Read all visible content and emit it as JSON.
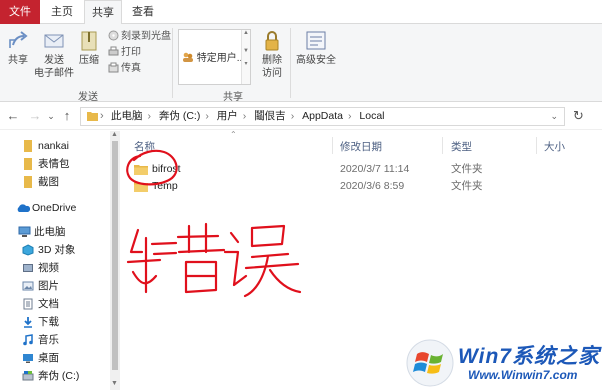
{
  "tabs": {
    "file": "文件",
    "home": "主页",
    "share": "共享",
    "view": "查看"
  },
  "ribbon": {
    "share_label": "共享",
    "send_label1": "发送",
    "send_label2": "电子邮件",
    "zip_label": "压缩",
    "burn_label": "刻录到光盘",
    "print_label": "打印",
    "fax_label": "传真",
    "group_send": "发送",
    "specific_users": "特定用户...",
    "group_share": "共享",
    "remove_access1": "删除",
    "remove_access2": "访问",
    "advanced_security": "高级安全"
  },
  "addressbar": {
    "crumbs": [
      "此电脑",
      "奔伪 (C:)",
      "用户",
      "鬮佷吉",
      "AppData",
      "Local"
    ]
  },
  "sidebar": {
    "items": [
      {
        "label": "nankai",
        "icon": "folder-icon"
      },
      {
        "label": "表情包",
        "icon": "folder-icon"
      },
      {
        "label": "截图",
        "icon": "folder-icon"
      },
      {
        "label": "OneDrive",
        "icon": "cloud-icon"
      },
      {
        "label": "此电脑",
        "icon": "computer-icon"
      },
      {
        "label": "3D 对象",
        "icon": "cube-icon"
      },
      {
        "label": "视频",
        "icon": "video-icon"
      },
      {
        "label": "图片",
        "icon": "picture-icon"
      },
      {
        "label": "文档",
        "icon": "document-icon"
      },
      {
        "label": "下载",
        "icon": "download-icon"
      },
      {
        "label": "音乐",
        "icon": "music-icon"
      },
      {
        "label": "桌面",
        "icon": "desktop-icon"
      },
      {
        "label": "奔伪 (C:)",
        "icon": "drive-icon"
      }
    ]
  },
  "list": {
    "columns": {
      "name": "名称",
      "modified": "修改日期",
      "type": "类型",
      "size": "大小"
    },
    "rows": [
      {
        "name": "bifrost",
        "modified": "2020/3/7 11:14",
        "type": "文件夹"
      },
      {
        "name": "Temp",
        "modified": "2020/3/6 8:59",
        "type": "文件夹"
      }
    ]
  },
  "annotation": {
    "handwritten_text": "错误",
    "color": "#e0101c"
  },
  "watermark": {
    "brand": "Win7系统之家",
    "url": "Www.Winwin7.com"
  },
  "colors": {
    "file_tab": "#c4232f",
    "folder": "#e8b94a",
    "column_header": "#4d6083",
    "watermark": "#1c58b8"
  }
}
